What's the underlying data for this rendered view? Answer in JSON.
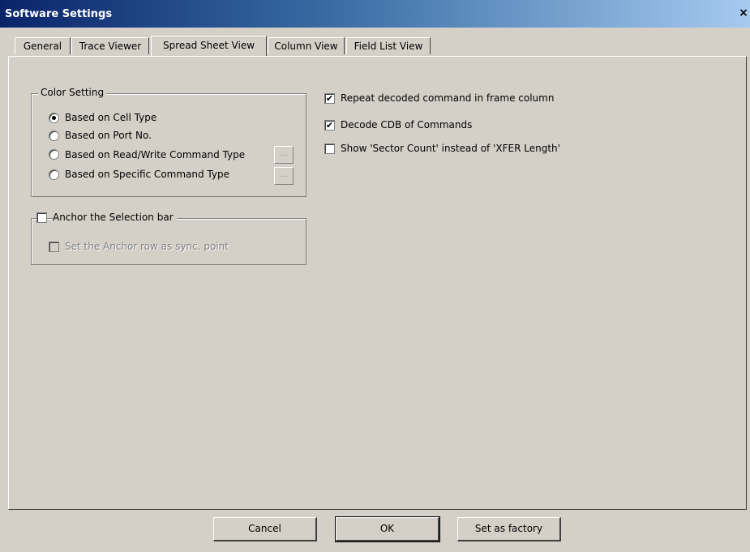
{
  "window": {
    "title": "Software Settings",
    "close_glyph": "×"
  },
  "tabs": [
    {
      "label": "General",
      "active": false
    },
    {
      "label": "Trace Viewer",
      "active": false
    },
    {
      "label": "Spread Sheet View",
      "active": true
    },
    {
      "label": "Column View",
      "active": false
    },
    {
      "label": "Field List View",
      "active": false
    }
  ],
  "color_setting": {
    "legend": "Color Setting",
    "options": [
      {
        "label": "Based on Cell Type",
        "selected": true
      },
      {
        "label": "Based on Port No.",
        "selected": false
      },
      {
        "label": "Based on Read/Write Command Type",
        "selected": false,
        "ellipsis": "..."
      },
      {
        "label": "Based on Specific Command Type",
        "selected": false,
        "ellipsis": "..."
      }
    ]
  },
  "anchor": {
    "label": "Anchor the Selection bar",
    "checked": false,
    "sync_label": "Set the Anchor row as sync. point",
    "sync_checked": false,
    "sync_enabled": false
  },
  "right_options": [
    {
      "label": "Repeat  decoded command in frame column",
      "checked": true
    },
    {
      "label": "Decode CDB of Commands",
      "checked": true
    },
    {
      "label": "Show 'Sector Count' instead of 'XFER Length'",
      "checked": false
    }
  ],
  "buttons": {
    "cancel": "Cancel",
    "ok": "OK",
    "factory": "Set as factory"
  },
  "check_glyph": "✔"
}
